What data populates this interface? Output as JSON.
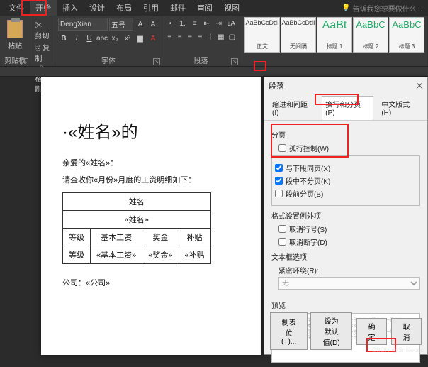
{
  "menu": {
    "items": [
      "文件",
      "开始",
      "插入",
      "设计",
      "布局",
      "引用",
      "邮件",
      "审阅",
      "视图"
    ],
    "tellme": "告诉我您想要做什么..."
  },
  "ribbon": {
    "clipboard": {
      "paste": "粘贴",
      "cut": "剪切",
      "copy": "复制",
      "format_painter": "格式刷",
      "label": "剪贴板"
    },
    "font": {
      "family": "DengXian",
      "size": "五号",
      "label": "字体"
    },
    "paragraph": {
      "label": "段落"
    },
    "styles": {
      "items": [
        {
          "preview": "AaBbCcDdI",
          "name": "正文"
        },
        {
          "preview": "AaBbCcDdI",
          "name": "无间隔"
        },
        {
          "preview": "AaBt",
          "name": "标题 1"
        },
        {
          "preview": "AaBbC",
          "name": "标题 2"
        },
        {
          "preview": "AaBbC",
          "name": "标题 3"
        }
      ]
    }
  },
  "document": {
    "title": "·«姓名»的",
    "greeting": "亲爱的«姓名»：",
    "line1": "请查收你«月份»月度的工资明细如下：",
    "table": {
      "header_name": "姓名",
      "name_val": "«姓名»",
      "cols": [
        "等级",
        "基本工资",
        "奖金",
        "补贴"
      ],
      "vals": [
        "等级",
        "«基本工资»",
        "«奖金»",
        "«补贴"
      ]
    },
    "company": "公司：«公司»"
  },
  "dialog": {
    "title": "段落",
    "tabs": [
      "缩进和间距(I)",
      "换行和分页(P)",
      "中文版式(H)"
    ],
    "section_pagination": "分页",
    "cb_widow": "孤行控制(W)",
    "cb_keep_next": "与下段同页(X)",
    "cb_keep_lines": "段中不分页(K)",
    "cb_page_break": "段前分页(B)",
    "section_format_exc": "格式设置例外项",
    "cb_no_line_num": "取消行号(S)",
    "cb_no_hyphen": "取消断字(D)",
    "section_textbox": "文本框选项",
    "tightwrap_label": "紧密环绕(R):",
    "tightwrap_value": "无",
    "section_preview": "预览",
    "btn_tabs": "制表位(T)...",
    "btn_default": "设为默认值(D)",
    "btn_ok": "确定",
    "btn_cancel": "取消"
  },
  "chart_data": {
    "type": "table",
    "note": "Document contains a simple 2-row table of salary fields with mail-merge placeholders, not a plotted chart."
  }
}
